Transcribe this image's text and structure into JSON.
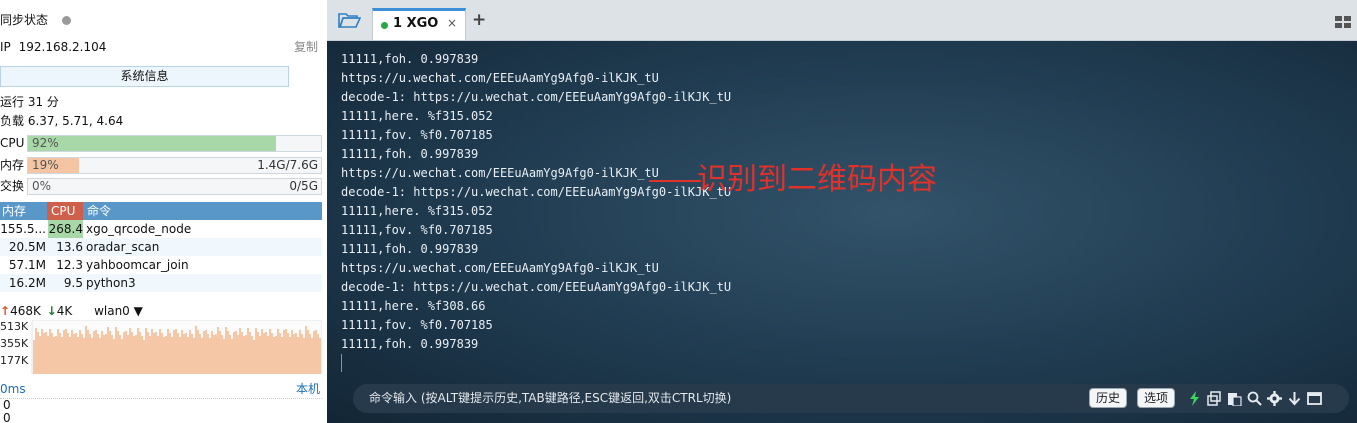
{
  "left": {
    "sync_status": "同步状态",
    "ip_label": "IP",
    "ip": "192.168.2.104",
    "copy": "复制",
    "sysinfo_button": "系统信息",
    "uptime": "运行 31 分",
    "load": "负载 6.37, 5.71, 4.64",
    "meters": [
      {
        "label": "CPU",
        "pct_text": "92%",
        "fraction": 0.92,
        "value": "",
        "color": "#a8d8a8"
      },
      {
        "label": "内存",
        "pct_text": "19%",
        "fraction": 0.19,
        "value": "1.4G/7.6G",
        "color": "#f5c5a3"
      },
      {
        "label": "交换",
        "pct_text": "0%",
        "fraction": 0.0,
        "value": "0/5G",
        "color": "#cde8cd"
      }
    ],
    "proc_headers": {
      "mem": "内存",
      "cpu": "CPU",
      "cmd": "命令"
    },
    "processes": [
      {
        "mem": "155.5...",
        "cpu": "268.4",
        "cmd": "xgo_qrcode_node"
      },
      {
        "mem": "20.5M",
        "cpu": "13.6",
        "cmd": "oradar_scan"
      },
      {
        "mem": "57.1M",
        "cpu": "12.3",
        "cmd": "yahboomcar_join"
      },
      {
        "mem": "16.2M",
        "cpu": "9.5",
        "cmd": "python3"
      }
    ],
    "net": {
      "up": "468K",
      "down": "4K",
      "iface": "wlan0",
      "ticks": [
        "513K",
        "355K",
        "177K"
      ]
    },
    "ping": {
      "ms": "0ms",
      "host": "本机",
      "vals": [
        "0",
        "0"
      ]
    },
    "colors": {
      "up": "#d9541e",
      "down": "#1d7a2f",
      "net_fill": "#f6c7a7",
      "proc_header": "#5a97c9",
      "cpu_header": "#cf5e4b"
    }
  },
  "right": {
    "tab": {
      "label": "1 XGO",
      "close": "×"
    },
    "plus": "+",
    "terminal_lines": [
      "11111,foh. 0.997839",
      "https://u.wechat.com/EEEuAamYg9Afg0-ilKJK_tU",
      "decode-1: https://u.wechat.com/EEEuAamYg9Afg0-ilKJK_tU",
      "11111,here. %f315.052",
      "11111,fov. %f0.707185",
      "11111,foh. 0.997839",
      "https://u.wechat.com/EEEuAamYg9Afg0-ilKJK_tU",
      "decode-1: https://u.wechat.com/EEEuAamYg9Afg0-ilKJK_tU",
      "11111,here. %f315.052",
      "11111,fov. %f0.707185",
      "11111,foh. 0.997839",
      "https://u.wechat.com/EEEuAamYg9Afg0-ilKJK_tU",
      "decode-1: https://u.wechat.com/EEEuAamYg9Afg0-ilKJK_tU",
      "11111,here. %f308.66",
      "11111,fov. %f0.707185",
      "11111,foh. 0.997839"
    ],
    "annotation": "识别到二维码内容",
    "command_placeholder": "命令输入 (按ALT键提示历史,TAB键路径,ESC键返回,双击CTRL切换)",
    "history_button": "历史",
    "options_button": "选项",
    "colors": {
      "annotation": "#e0312a",
      "tab_dot": "#27a844",
      "terminal_text": "#e8eef3"
    }
  }
}
